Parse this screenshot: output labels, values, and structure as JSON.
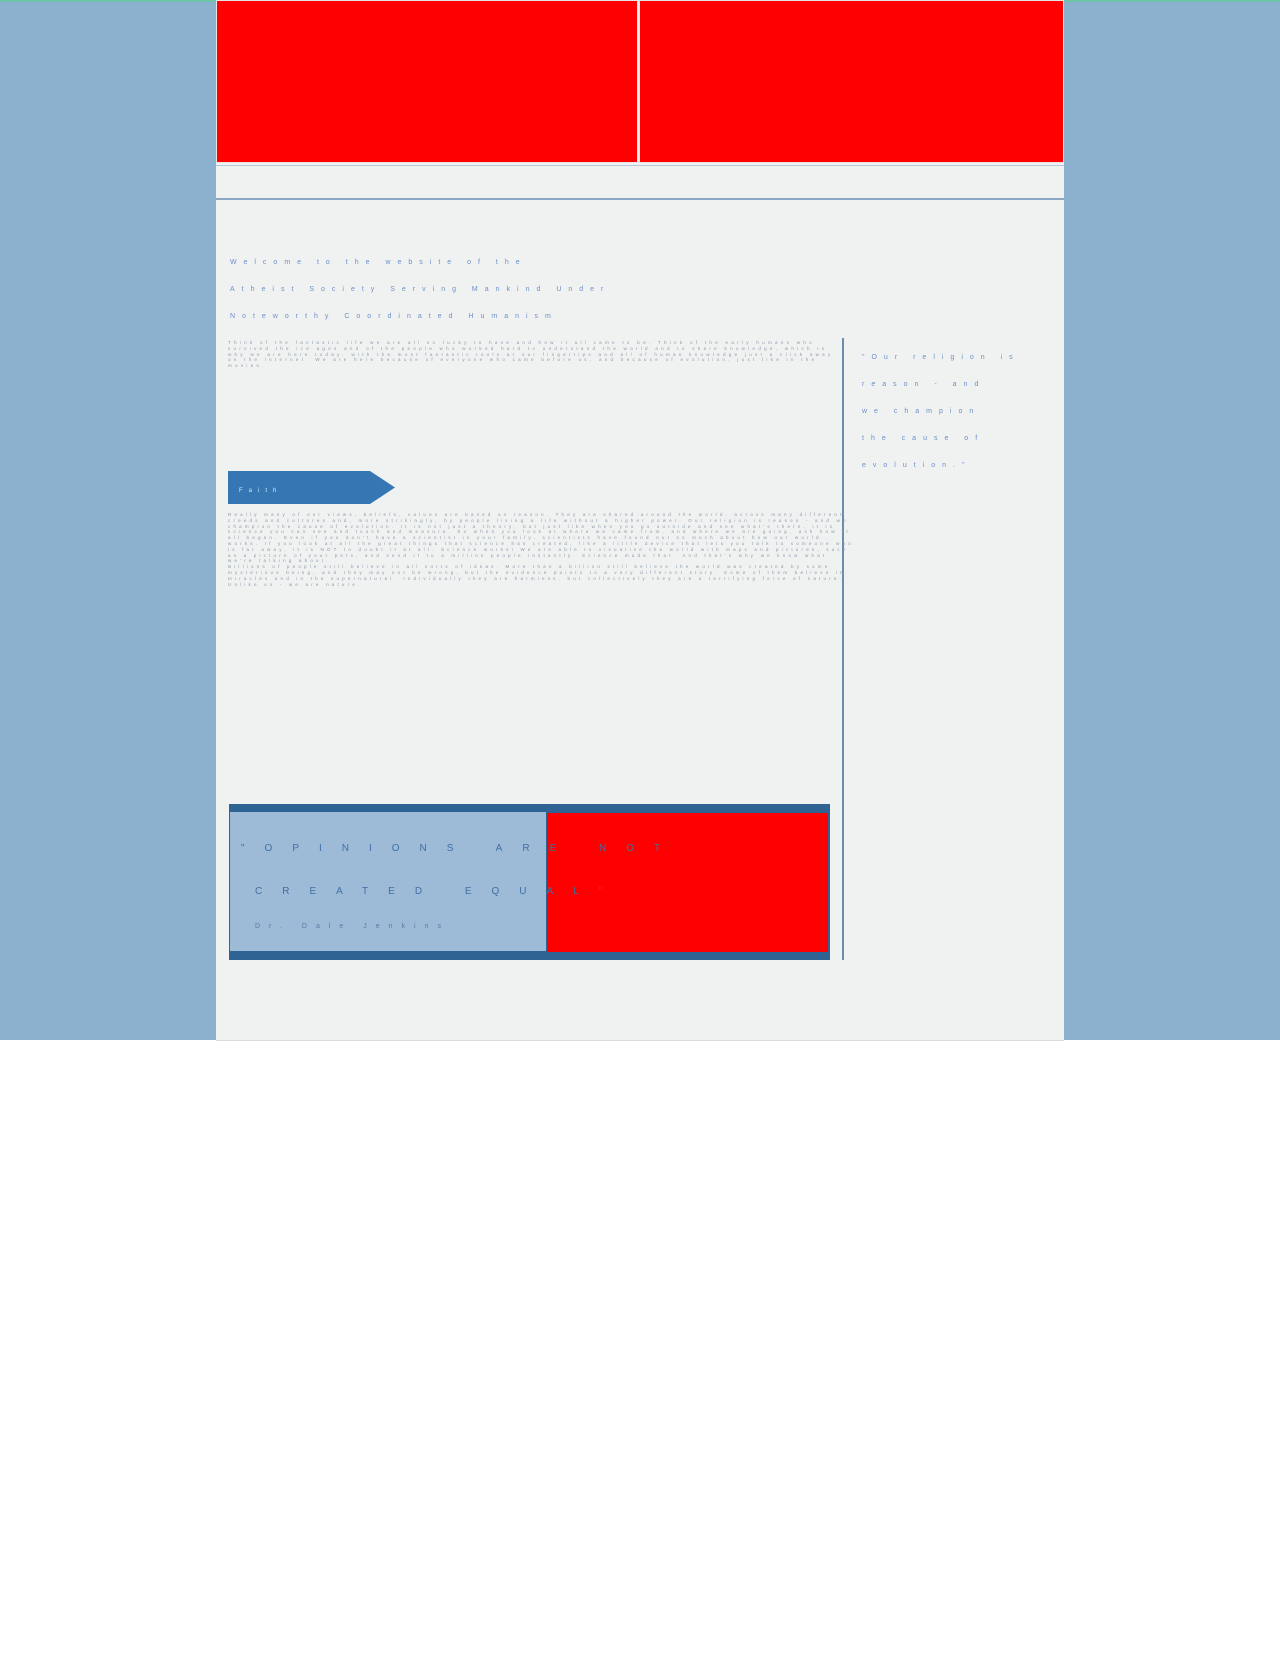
{
  "welcome": {
    "line1": "Welcome to the website of the",
    "line2": "Atheist Society Serving Mankind Under",
    "line3": "Noteworthy Coordinated Humanism"
  },
  "intro_paragraph": "Think of the fantastic life we are all so lucky to have and how it all came to be. Think of the early humans who survived the ice ages and of the people who worked hard to understand the world and to share knowledge, which is why we are here today, with the most fantastic tools at our fingertips and all of human knowledge just a click away on the internet. We are here because of everyone who came before us, and because of evolution, just like in the movies.",
  "pull_quote": {
    "line1": "\"Our religion is",
    "line2": "reason - and",
    "line3": "we champion",
    "line4": "the cause of",
    "line5": "evolution.\""
  },
  "faith_tab": {
    "label": "Faith"
  },
  "faith_paragraphs": [
    "Really many of our views, beliefs, values are based on reason. They are shared around the world, across many different creeds and cultures and, more strikingly, by people living a life without a higher power. Our religion is reason - and we champion the cause of evolution. It is not just a theory, but just like when you go outside and see what's there, it is science you can see and touch and measure. So when you look at where we came from, and where we are going, ask how it all began. Even if you don't have a scientist in your family, scientists have found out so much about how our world works. If you look at all the great things that science has created, like a little device that lets you talk to someone who is far away, it is NOT to doubt it at all. Science works! We are able to visualise the world with maps and pictures, such as a picture of your pets, and send it to a million people instantly. Science made that. And that's why we know what we're talking about.",
    "Billions of people still believe in all sorts of ideas. More than a billion still believe the world was created by some mysterious being, and they may not be wrong, but the evidence points to a very different story. Some of them believe in miracles and in the supernatural. Individually they are harmless, but collectively they are a terrifying force of nature. Unlike us - we are nature."
  ],
  "quote_box": {
    "line1": "\"OPINIONS ARE NOT",
    "line2": "CREATED EQUAL\"",
    "author": "Dr. Dale Jenkins"
  },
  "colors": {
    "background_band": "#8cb1cf",
    "page": "#f0f2f2",
    "accent": "#3577b3",
    "quote_frame": "#2f6393",
    "image_placeholder": "#ff0000"
  }
}
